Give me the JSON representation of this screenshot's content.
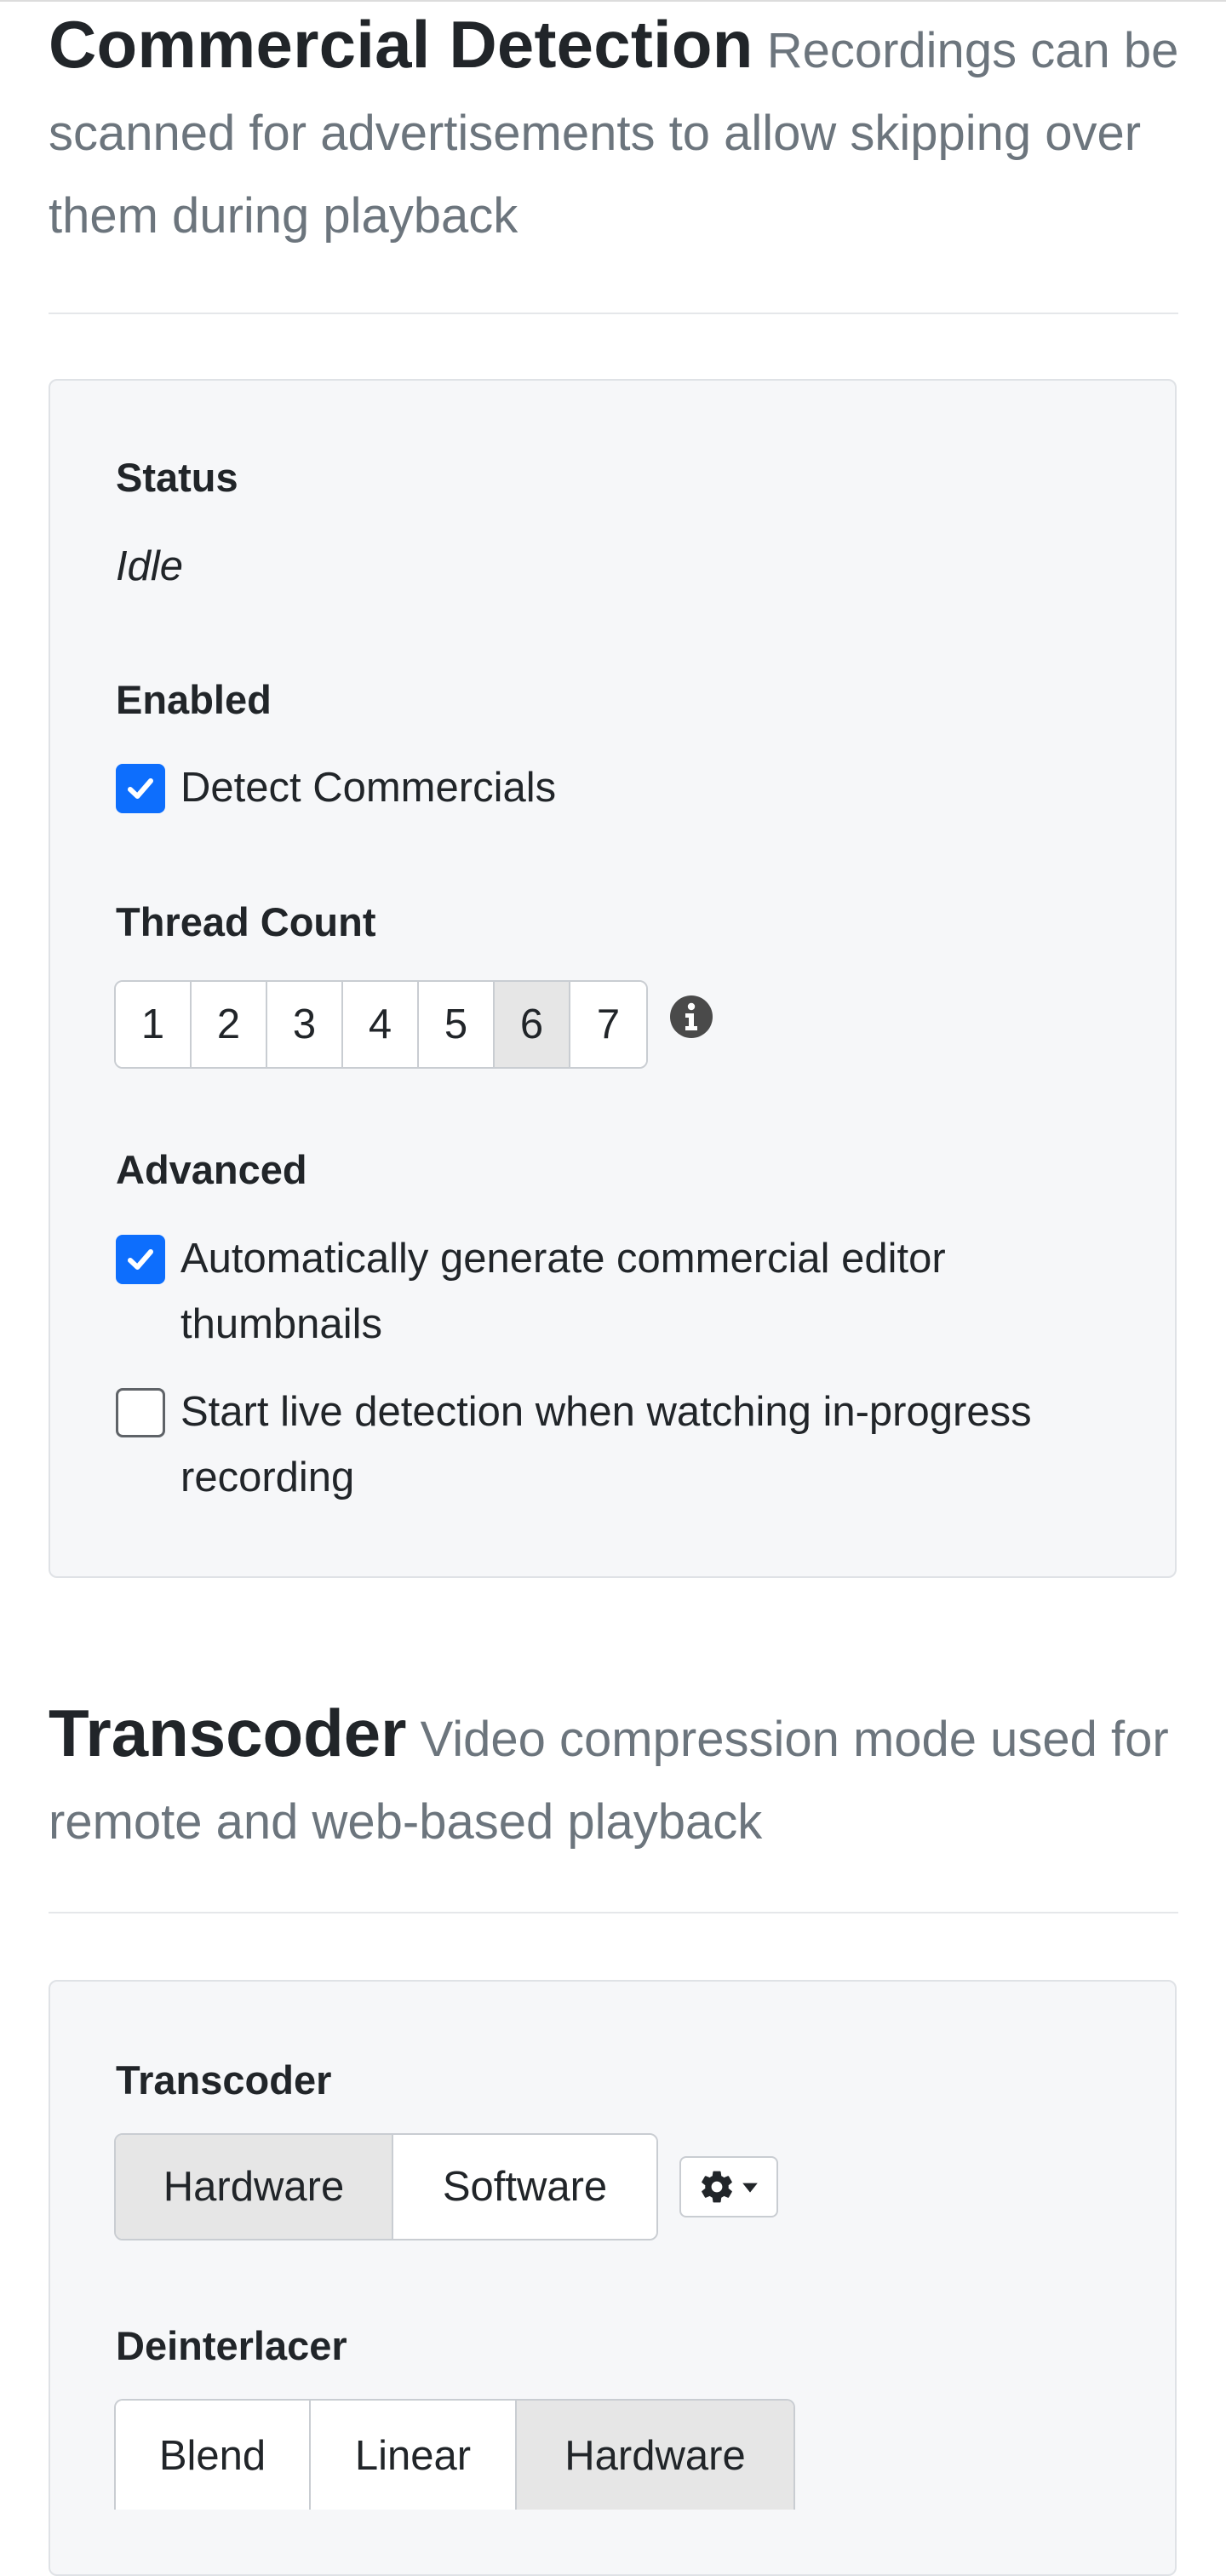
{
  "commercial_detection": {
    "title": "Commercial Detection",
    "subtitle": "Recordings can be scanned for advertisements to allow skipping over them during playback",
    "status_label": "Status",
    "status_value": "Idle",
    "enabled_label": "Enabled",
    "detect_commercials": {
      "label": "Detect Commercials",
      "checked": true
    },
    "thread_count_label": "Thread Count",
    "thread_options": [
      "1",
      "2",
      "3",
      "4",
      "5",
      "6",
      "7"
    ],
    "thread_selected": "6",
    "advanced_label": "Advanced",
    "auto_thumbnails": {
      "label": "Automatically generate commercial editor thumbnails",
      "checked": true
    },
    "live_detection": {
      "label": "Start live detection when watching in-progress recording",
      "checked": false
    }
  },
  "transcoder_section": {
    "title": "Transcoder",
    "subtitle": "Video compression mode used for remote and web-based playback",
    "transcoder_label": "Transcoder",
    "transcoder_options": [
      "Hardware",
      "Software"
    ],
    "transcoder_selected": "Hardware",
    "deinterlacer_label": "Deinterlacer",
    "deinterlacer_options": [
      "Blend",
      "Linear",
      "Hardware"
    ],
    "deinterlacer_selected": "Hardware"
  },
  "colors": {
    "accent": "#0d6efd",
    "muted_text": "#6c757d",
    "card_bg": "#f6f7f9",
    "active_segment": "#e6e6e6"
  },
  "icons": {
    "info": "info-circle-icon",
    "settings": "gear-icon",
    "dropdown": "caret-down-icon",
    "check": "checkmark-icon"
  }
}
